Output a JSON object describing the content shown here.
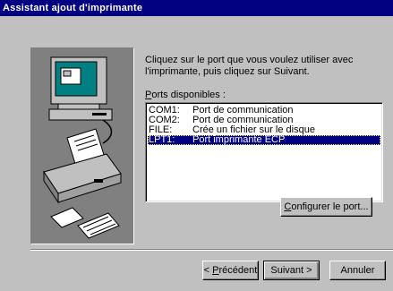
{
  "window": {
    "title": "Assistant ajout d'imprimante"
  },
  "instructions": {
    "line1": "Cliquez sur le port que vous voulez utiliser avec",
    "line2": "l'imprimante, puis cliquez sur Suivant."
  },
  "ports": {
    "label_accel": "P",
    "label_rest": "orts disponibles :",
    "items": [
      {
        "port": "COM1:",
        "description": "Port de communication",
        "selected": false
      },
      {
        "port": "COM2:",
        "description": "Port de communication",
        "selected": false
      },
      {
        "port": "FILE:",
        "description": "Crée un fichier sur le disque",
        "selected": false
      },
      {
        "port": "LPT1:",
        "description": "Port imprimante ECP",
        "selected": true
      }
    ]
  },
  "buttons": {
    "configure_accel": "C",
    "configure_rest": "onfigurer le port...",
    "back_prefix": "< ",
    "back_accel": "P",
    "back_rest": "récédent",
    "next": "Suivant >",
    "cancel": "Annuler"
  },
  "illustration": {
    "icon": "computer-printer-wizard-icon"
  }
}
